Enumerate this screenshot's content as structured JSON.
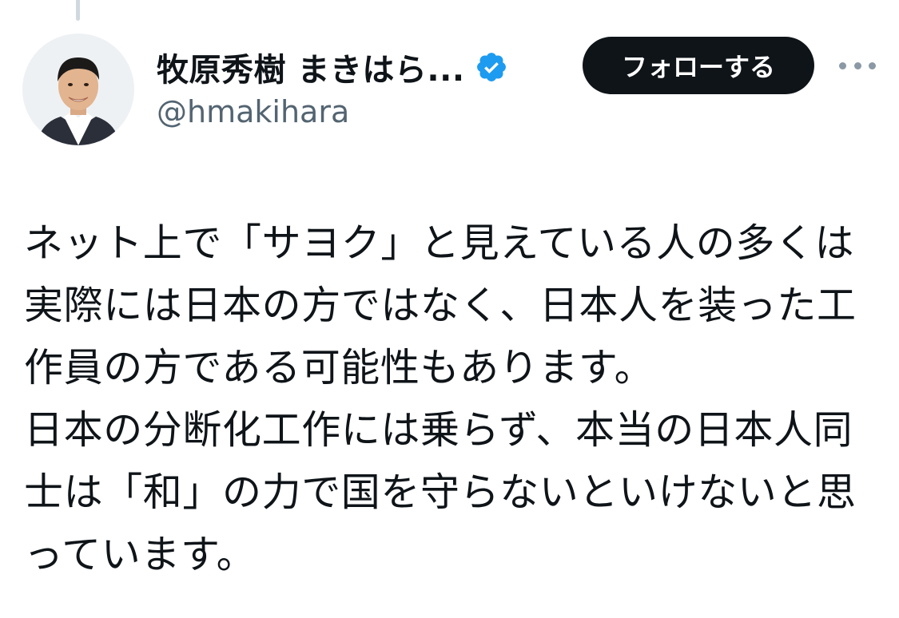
{
  "author": {
    "display_name": "牧原秀樹 まきはら...",
    "handle": "@hmakihara",
    "verified": true,
    "verified_color": "#1d9bf0",
    "avatar_icon": "profile-photo"
  },
  "actions": {
    "follow_label": "フォローする",
    "more_icon": "ellipsis-horizontal-icon"
  },
  "tweet": {
    "lines": [
      "ネット上で「サヨク」と見えている人の多くは",
      "実際には日本の方ではなく、日本人を装った工",
      "作員の方である可能性もあります。",
      "日本の分断化工作には乗らず、本当の日本人同",
      "士は「和」の力で国を守らないといけないと思",
      "っています。"
    ]
  },
  "colors": {
    "text_primary": "#0f1419",
    "text_secondary": "#536471",
    "button_bg": "#0f1419",
    "button_text": "#ffffff"
  }
}
